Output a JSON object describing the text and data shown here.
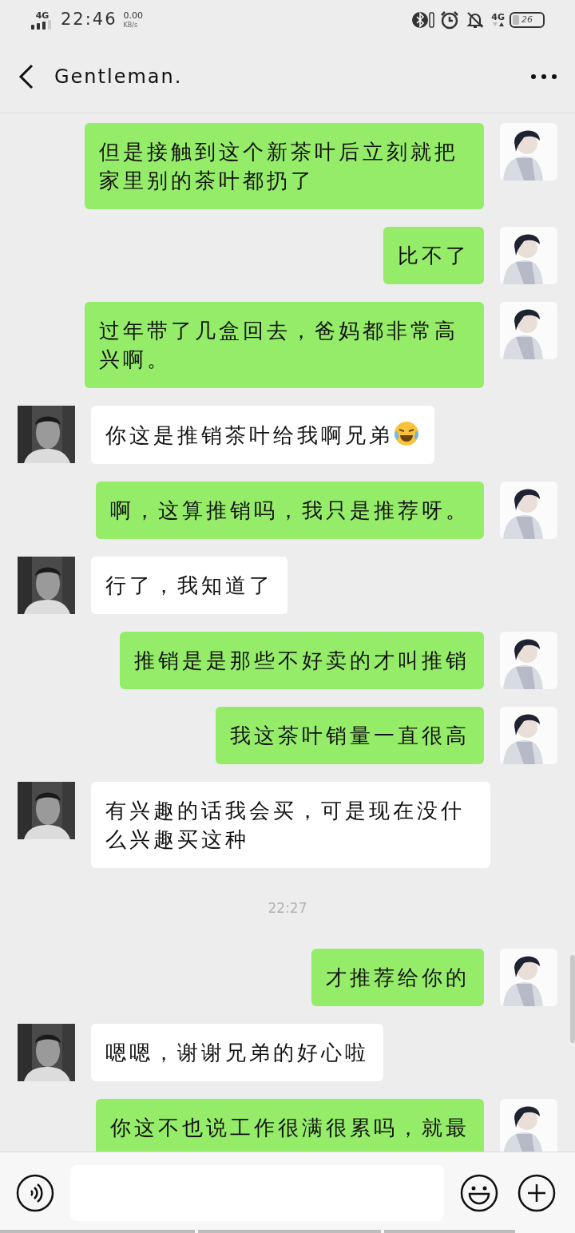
{
  "status_bar": {
    "network": "4G",
    "time": "22:46",
    "speed": "0.00",
    "speed_unit": "KB/s",
    "network_right": "4G",
    "battery": "26"
  },
  "header": {
    "title": "Gentleman."
  },
  "messages": [
    {
      "kind": "sent",
      "text": "但是接触到这个新茶叶后立刻就把家里别的茶叶都扔了"
    },
    {
      "kind": "sent",
      "text": "比不了"
    },
    {
      "kind": "sent",
      "text": "过年带了几盒回去，爸妈都非常高兴啊。"
    },
    {
      "kind": "received",
      "text": "你这是推销茶叶给我啊兄弟",
      "trailing_emoji": true
    },
    {
      "kind": "sent",
      "text": "啊，这算推销吗，我只是推荐呀。"
    },
    {
      "kind": "received",
      "text": "行了，我知道了"
    },
    {
      "kind": "sent",
      "text": "推销是是那些不好卖的才叫推销"
    },
    {
      "kind": "sent",
      "text": "我这茶叶销量一直很高"
    },
    {
      "kind": "received",
      "text": "有兴趣的话我会买，可是现在没什么兴趣买这种"
    },
    {
      "kind": "time",
      "text": "22:27"
    },
    {
      "kind": "sent",
      "text": "才推荐给你的"
    },
    {
      "kind": "received",
      "text": "嗯嗯，谢谢兄弟的好心啦"
    },
    {
      "kind": "sent",
      "text": "你这不也说工作很满很累吗，就最",
      "cut_off": true
    }
  ]
}
